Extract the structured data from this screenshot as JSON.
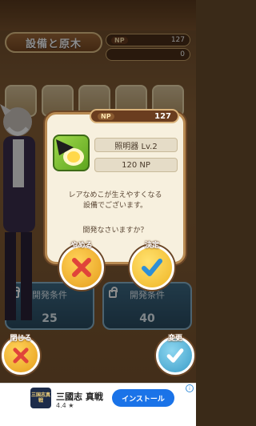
{
  "header": {
    "title": "設備と原木",
    "np_label": "NP",
    "np_value": "127",
    "favorites_value": "0"
  },
  "modal": {
    "np_label": "NP",
    "np_value": "127",
    "item_name": "照明器 Lv.2",
    "item_cost": "120 NP",
    "description_line1": "レアなめこが生えやすくなる",
    "description_line2": "設備でございます。",
    "confirm_text": "開発なさいますか？",
    "cancel_label": "やめる",
    "ok_label": "決定"
  },
  "conditions": [
    {
      "label": "開発条件",
      "value": "25"
    },
    {
      "label": "開発条件",
      "value": "40"
    }
  ],
  "footer": {
    "close_label": "閉じる",
    "change_label": "変更"
  },
  "ad": {
    "logo_text": "三国志真戦",
    "title": "三國志 真戦",
    "rating": "4.4 ★",
    "install_label": "インストール",
    "info_icon": "i"
  },
  "colors": {
    "modal_bg": "#f7f0de",
    "modal_border": "#b88a52",
    "cancel_x": "#e0443a",
    "ok_check": "#2e8fd6",
    "ad_button": "#1a73e8"
  }
}
